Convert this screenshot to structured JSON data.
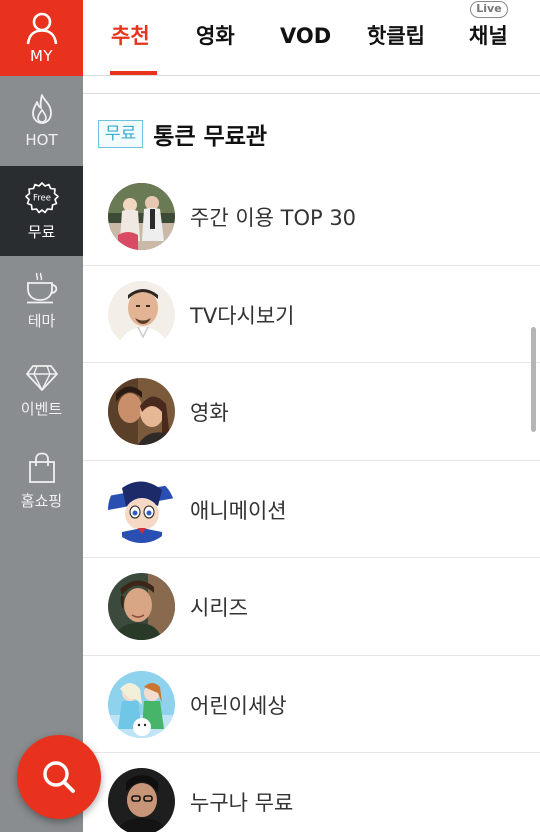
{
  "rail": {
    "my_label": "MY",
    "items": [
      {
        "label": "HOT",
        "icon": "flame-icon"
      },
      {
        "label": "무료",
        "icon": "free-badge-icon",
        "badge_text": "Free"
      },
      {
        "label": "테마",
        "icon": "coffee-cup-icon"
      },
      {
        "label": "이벤트",
        "icon": "diamond-icon"
      },
      {
        "label": "홈쇼핑",
        "icon": "shopping-bag-icon"
      }
    ],
    "active_index": 1
  },
  "tabs": {
    "items": [
      {
        "label": "추천"
      },
      {
        "label": "영화"
      },
      {
        "label": "VOD"
      },
      {
        "label": "핫클립"
      },
      {
        "label": "채널"
      }
    ],
    "active_index": 0,
    "live_badge": "Live"
  },
  "section": {
    "tag": "무료",
    "title": "통큰 무료관"
  },
  "list": [
    {
      "label": "주간 이용 TOP 30"
    },
    {
      "label": "TV다시보기"
    },
    {
      "label": "영화"
    },
    {
      "label": "애니메이션"
    },
    {
      "label": "시리즈"
    },
    {
      "label": "어린이세상"
    },
    {
      "label": "누구나 무료"
    }
  ],
  "colors": {
    "accent": "#e8321e",
    "rail": "#8a8d8f",
    "rail_active": "#2a2d2f",
    "tag_blue": "#3aaed0"
  },
  "fab": {
    "icon": "search-icon"
  }
}
